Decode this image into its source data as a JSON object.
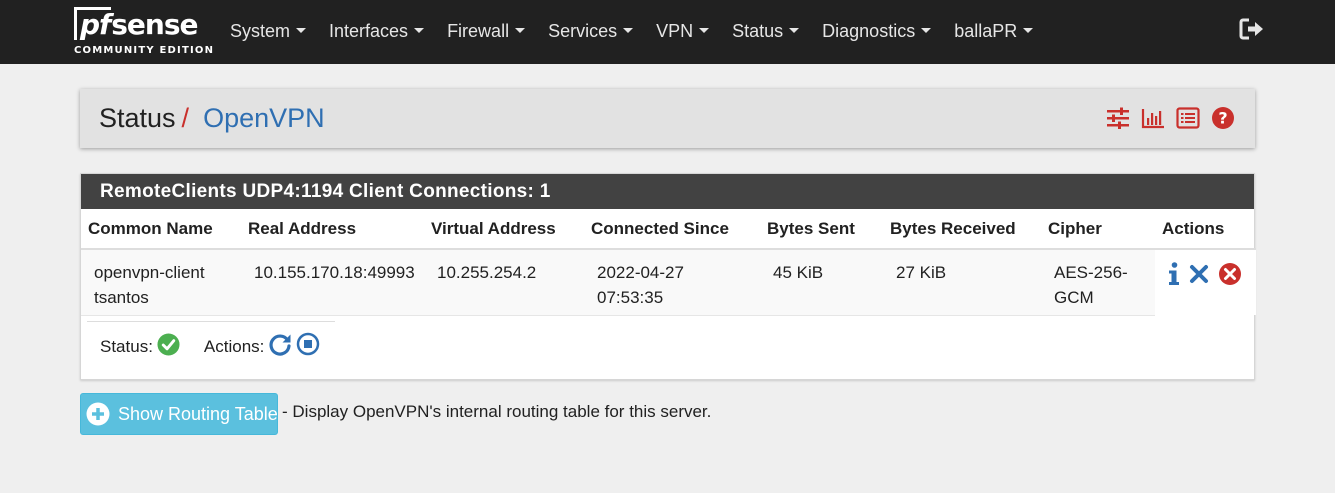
{
  "brand": {
    "logo_text": "pfsense",
    "edition": "COMMUNITY EDITION"
  },
  "nav": {
    "items": [
      "System",
      "Interfaces",
      "Firewall",
      "Services",
      "VPN",
      "Status",
      "Diagnostics",
      "ballaPR"
    ]
  },
  "breadcrumb": {
    "section": "Status",
    "separator": "/",
    "page": "OpenVPN"
  },
  "header_icons": [
    "sliders-icon",
    "bar-chart-icon",
    "list-icon",
    "help-icon"
  ],
  "panel": {
    "title": "RemoteClients UDP4:1194 Client Connections: 1",
    "columns": [
      "Common Name",
      "Real Address",
      "Virtual Address",
      "Connected Since",
      "Bytes Sent",
      "Bytes Received",
      "Cipher",
      "Actions"
    ],
    "row": {
      "common_name_1": "openvpn-client",
      "common_name_2": "tsantos",
      "real_address": "10.155.170.18:49993",
      "virtual_address": "10.255.254.2",
      "connected_date": "2022-04-27",
      "connected_time": "07:53:35",
      "bytes_sent": "45 KiB",
      "bytes_received": "27 KiB",
      "cipher_1": "AES-256-",
      "cipher_2": "GCM"
    },
    "status_label": "Status:",
    "actions_label": "Actions:"
  },
  "routing": {
    "button_label": "Show Routing Table",
    "description": "- Display OpenVPN's internal routing table for this server."
  },
  "colors": {
    "navbar": "#212121",
    "accent_red": "#c9302c",
    "link_blue": "#2f6fb2",
    "info_button": "#5bc0de",
    "success_green": "#4caf50"
  }
}
